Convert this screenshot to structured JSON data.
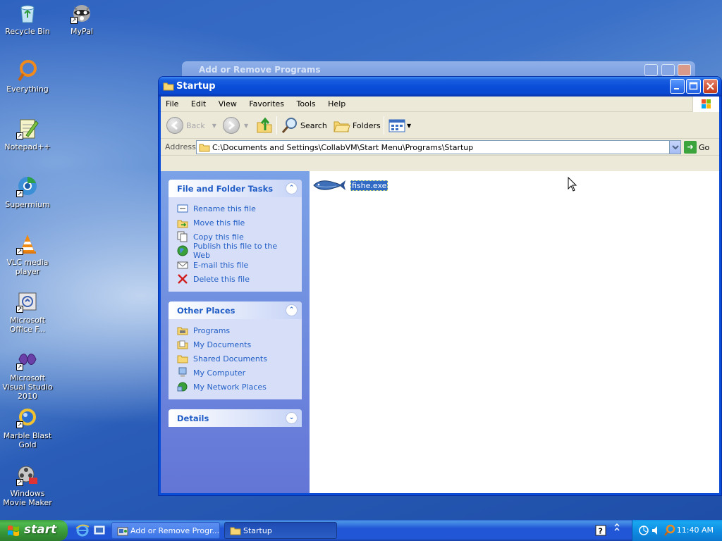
{
  "desktop": {
    "icons": [
      {
        "label": "Recycle Bin"
      },
      {
        "label": "MyPal"
      },
      {
        "label": "Everything"
      },
      {
        "label": "Notepad++"
      },
      {
        "label": "Supermium"
      },
      {
        "label": "VLC media player"
      },
      {
        "label": "Microsoft Office F..."
      },
      {
        "label": "Microsoft Visual Studio 2010"
      },
      {
        "label": "Marble Blast Gold"
      },
      {
        "label": "Windows Movie Maker"
      }
    ]
  },
  "background_window": {
    "title": "Add or Remove Programs"
  },
  "window": {
    "title": "Startup",
    "menu": [
      "File",
      "Edit",
      "View",
      "Favorites",
      "Tools",
      "Help"
    ],
    "toolbar": {
      "back_label": "Back",
      "search_label": "Search",
      "folders_label": "Folders"
    },
    "address": {
      "label": "Address",
      "path": "C:\\Documents and Settings\\CollabVM\\Start Menu\\Programs\\Startup",
      "go_label": "Go"
    },
    "taskpane": {
      "file_tasks": {
        "title": "File and Folder Tasks",
        "items": [
          "Rename this file",
          "Move this file",
          "Copy this file",
          "Publish this file to the Web",
          "E-mail this file",
          "Delete this file"
        ]
      },
      "other_places": {
        "title": "Other Places",
        "items": [
          "Programs",
          "My Documents",
          "Shared Documents",
          "My Computer",
          "My Network Places"
        ]
      },
      "details": {
        "title": "Details"
      }
    },
    "files": [
      {
        "name": "fishe.exe",
        "selected": true
      }
    ]
  },
  "taskbar": {
    "start_label": "start",
    "tasks": [
      {
        "label": "Add or Remove Progr...",
        "active": false
      },
      {
        "label": "Startup",
        "active": true
      }
    ],
    "clock": "11:40 AM"
  },
  "colors": {
    "titlebar": "#0a4ed8",
    "taskpane_link": "#215dc6",
    "selection": "#316ac5",
    "start_green": "#379637"
  }
}
